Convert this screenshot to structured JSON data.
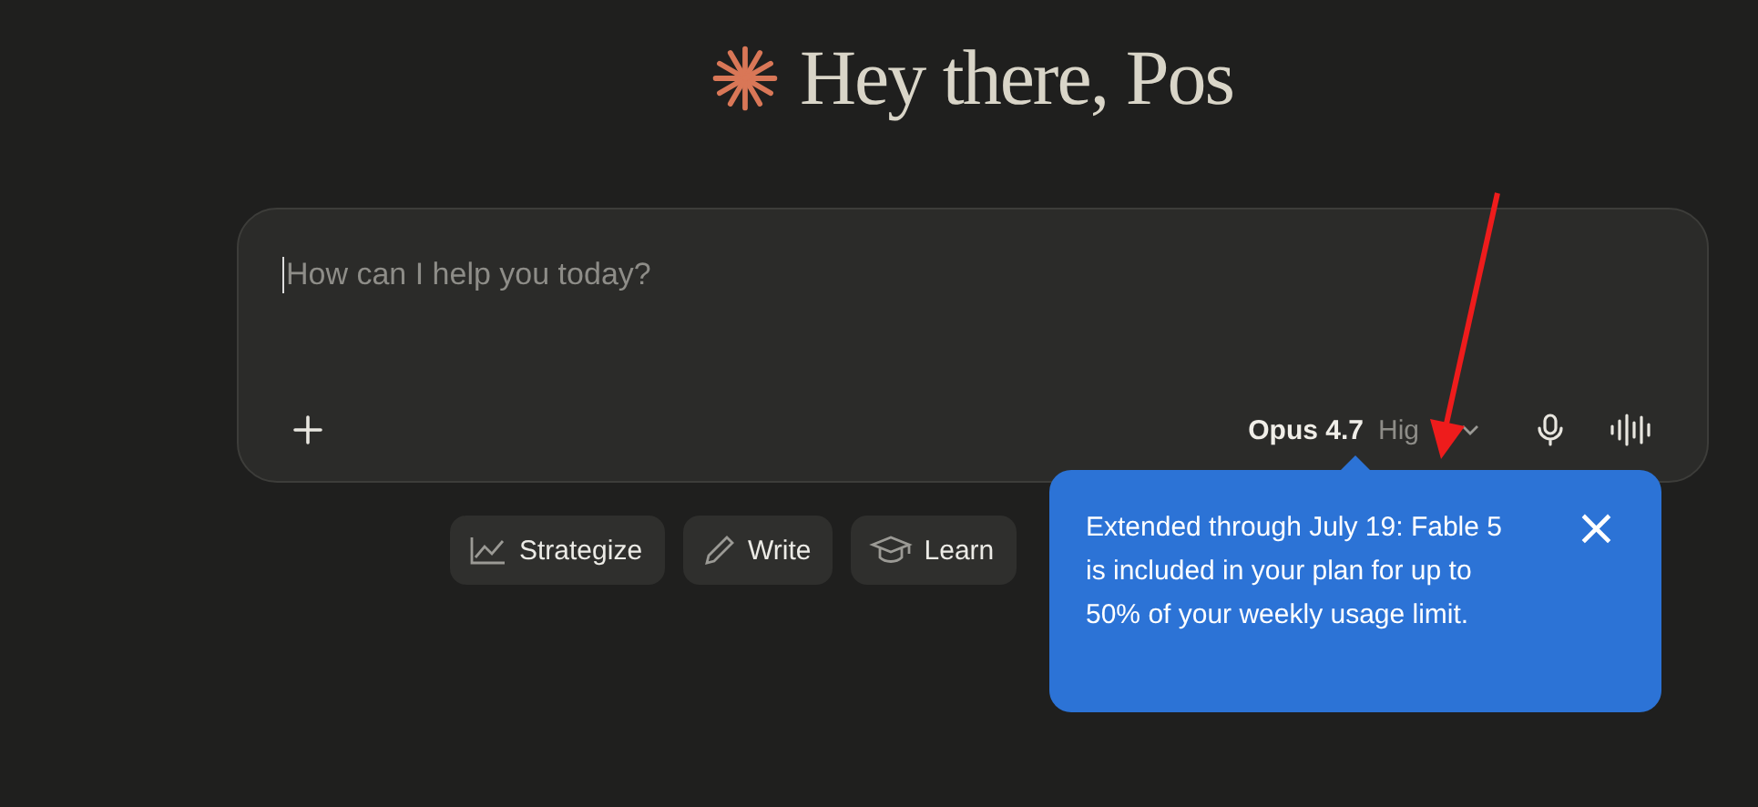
{
  "greeting": "Hey there, Pos",
  "composer": {
    "placeholder": "How can I help you today?",
    "model": "Opus 4.7",
    "effort": "Hig"
  },
  "suggestions": [
    {
      "kind": "chart",
      "label": "Strategize"
    },
    {
      "kind": "pencil",
      "label": "Write"
    },
    {
      "kind": "cap",
      "label": "Learn"
    }
  ],
  "tooltip": {
    "text": "Extended through July 19: Fable 5 is included in your plan for up to 50% of your weekly usage limit.",
    "close": "×"
  }
}
